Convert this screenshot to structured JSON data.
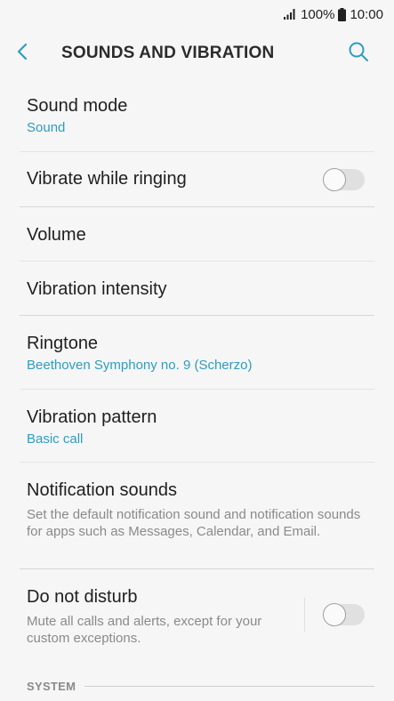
{
  "status_bar": {
    "signal_icon": "signal-icon",
    "battery_percent": "100%",
    "battery_icon": "battery-icon",
    "time": "10:00"
  },
  "header": {
    "back_icon": "chevron-left-icon",
    "title": "SOUNDS AND VIBRATION",
    "search_icon": "search-icon"
  },
  "colors": {
    "accent": "#2d9dbf",
    "background": "#f6f6f6",
    "secondary_text": "#8a8a8a"
  },
  "items": [
    {
      "title": "Sound mode",
      "subtitle": "Sound"
    },
    {
      "title": "Vibrate while ringing",
      "toggle": false
    },
    {
      "title": "Volume"
    },
    {
      "title": "Vibration intensity"
    },
    {
      "title": "Ringtone",
      "subtitle": "Beethoven Symphony no. 9 (Scherzo)"
    },
    {
      "title": "Vibration pattern",
      "subtitle": "Basic call"
    },
    {
      "title": "Notification sounds",
      "description": "Set the default notification sound and notification sounds for apps such as Messages, Calendar, and Email."
    },
    {
      "title": "Do not disturb",
      "description": "Mute all calls and alerts, except for your custom exceptions.",
      "toggle": false
    }
  ],
  "section": {
    "label": "SYSTEM"
  }
}
